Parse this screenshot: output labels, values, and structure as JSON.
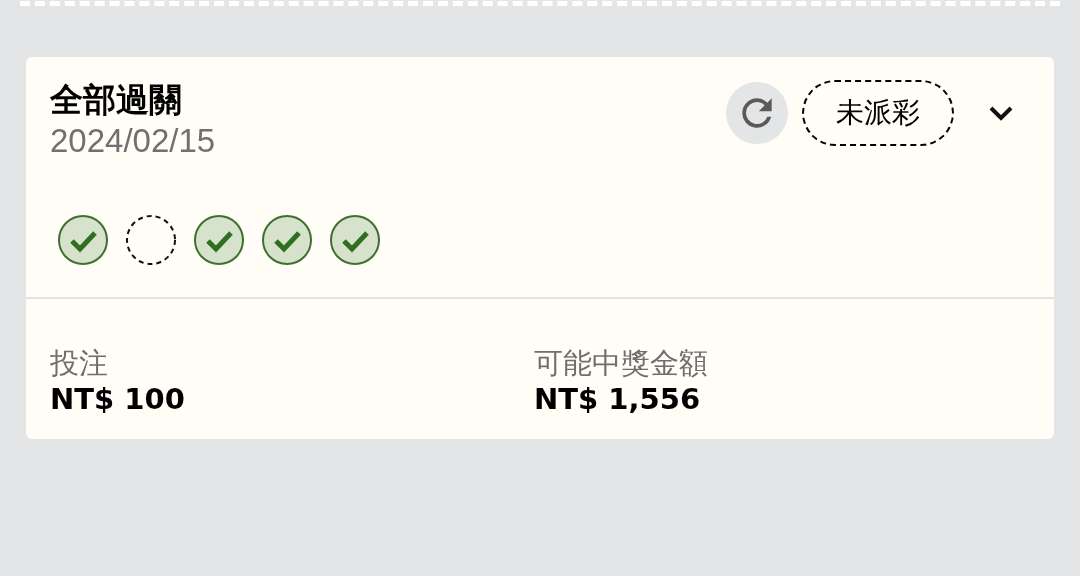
{
  "bet": {
    "title": "全部過關",
    "date": "2024/02/15",
    "status": "未派彩",
    "expanded": false,
    "legs": [
      {
        "won": true
      },
      {
        "won": false
      },
      {
        "won": true
      },
      {
        "won": true
      },
      {
        "won": true
      }
    ],
    "stake": {
      "label": "投注",
      "value": "NT$ 100"
    },
    "payout": {
      "label": "可能中獎金額",
      "value": "NT$ 1,556"
    }
  }
}
